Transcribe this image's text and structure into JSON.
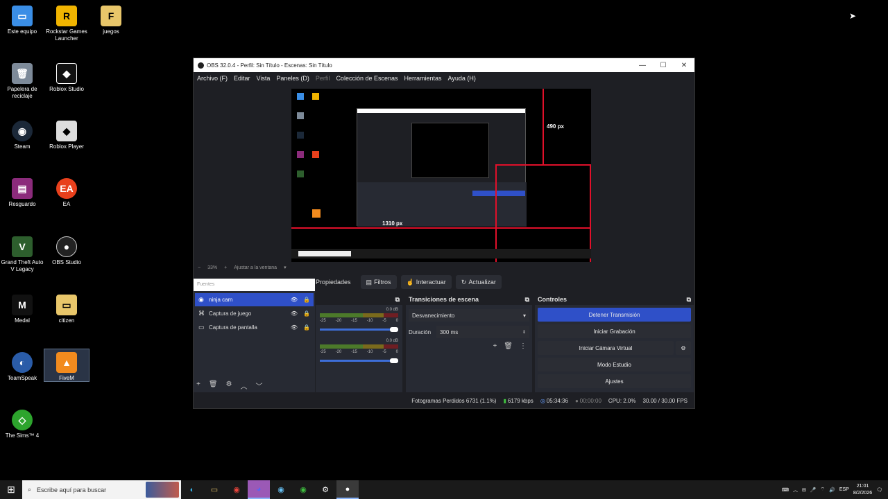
{
  "desktop": {
    "icons": [
      {
        "label": "Este equipo",
        "icon": "computer-icon"
      },
      {
        "label": "Rockstar Games Launcher",
        "icon": "rockstar-icon"
      },
      {
        "label": "juegos",
        "icon": "folder-icon"
      },
      {
        "label": "Papelera de reciclaje",
        "icon": "recycle-bin-icon"
      },
      {
        "label": "Roblox Studio",
        "icon": "roblox-studio-icon"
      },
      {
        "label": "Steam",
        "icon": "steam-icon"
      },
      {
        "label": "Roblox Player",
        "icon": "roblox-icon"
      },
      {
        "label": "Resguardo",
        "icon": "winrar-icon"
      },
      {
        "label": "EA",
        "icon": "ea-icon"
      },
      {
        "label": "Grand Theft Auto V Legacy",
        "icon": "gta-icon"
      },
      {
        "label": "OBS Studio",
        "icon": "obs-icon"
      },
      {
        "label": "Medal",
        "icon": "medal-icon"
      },
      {
        "label": "citizen",
        "icon": "folder-icon"
      },
      {
        "label": "TeamSpeak",
        "icon": "teamspeak-icon"
      },
      {
        "label": "FiveM",
        "icon": "fivem-icon"
      },
      {
        "label": "The Sims™ 4",
        "icon": "sims-icon"
      }
    ]
  },
  "obs": {
    "title": "OBS 32.0.4 - Perfil: Sin Título - Escenas: Sin Título",
    "menu": [
      "Archivo (F)",
      "Editar",
      "Vista",
      "Paneles (D)",
      "Perfil",
      "Colección de Escenas",
      "Herramientas",
      "Ayuda (H)"
    ],
    "preview": {
      "height_label": "490 px",
      "width_label": "1310 px",
      "zoom": "33%",
      "fit_label": "Ajustar a la ventana"
    },
    "source_toolbar": {
      "properties": "Propiedades",
      "filters": "Filtros",
      "interact": "Interactuar",
      "refresh": "Actualizar"
    },
    "sources": {
      "search_placeholder": "Fuentes",
      "items": [
        "ninja cam",
        "Captura de juego",
        "Captura de pantalla"
      ]
    },
    "mixer": {
      "tracks": [
        {
          "db": "0.0 dB"
        },
        {
          "db": "0.0 dB"
        }
      ],
      "scale": [
        "-25",
        "-20",
        "-15",
        "-10",
        "-5",
        "0"
      ]
    },
    "transitions": {
      "title": "Transiciones de escena",
      "selected": "Desvanecimiento",
      "duration_label": "Duración",
      "duration_value": "300 ms"
    },
    "controls": {
      "title": "Controles",
      "stop_stream": "Detener Transmisión",
      "start_recording": "Iniciar Grabación",
      "virtual_camera": "Iniciar Cámara Virtual",
      "studio_mode": "Modo Estudio",
      "settings": "Ajustes"
    },
    "status": {
      "dropped_frames": "Fotogramas Perdidos 6731 (1.1%)",
      "bitrate": "6179 kbps",
      "stream_time": "05:34:36",
      "rec_time": "00:00:00",
      "cpu": "CPU: 2.0%",
      "fps": "30.00 / 30.00 FPS"
    }
  },
  "taskbar": {
    "search_placeholder": "Escribe aquí para buscar",
    "language": "ESP",
    "time": "21:01",
    "date": "8/2/2026"
  }
}
